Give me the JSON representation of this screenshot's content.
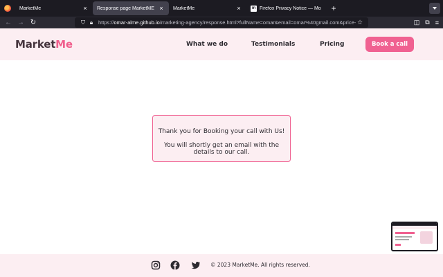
{
  "browser": {
    "tabs": [
      {
        "label": "MarketMe",
        "close": "×"
      },
      {
        "label": "Response page MarketME",
        "close": "×"
      },
      {
        "label": "MarketMe",
        "close": "×"
      },
      {
        "label": "Firefox Privacy Notice — Mozilla",
        "close": "×",
        "favicon": "m"
      }
    ],
    "new_tab": "+",
    "url_host": "omar-alme.github.io",
    "url_prefix": "https://",
    "url_path": "/marketing-agency/response.html?fullName=omar&email=omar%40gmail.com&price-plan",
    "icons": [
      "firefox-icon",
      "back-icon",
      "forward-icon",
      "reload-icon",
      "shield-icon",
      "lock-icon",
      "star-icon",
      "pocket-icon",
      "extensions-icon",
      "menu-icon"
    ]
  },
  "site": {
    "logo_main": "Market",
    "logo_accent": "Me",
    "nav": [
      "What we do",
      "Testimonials",
      "Pricing"
    ],
    "cta": "Book a call",
    "message_line1": "Thank you for Booking your call with Us!",
    "message_line2": "You will shortly get an email with the details to our call.",
    "footer_copyright": "© 2023 MarketMe. All rights reserved.",
    "social": [
      "instagram-icon",
      "facebook-icon",
      "twitter-icon"
    ]
  },
  "colors": {
    "accent": "#f06191",
    "header_bg": "#fceef2",
    "text": "#2d2a30"
  }
}
